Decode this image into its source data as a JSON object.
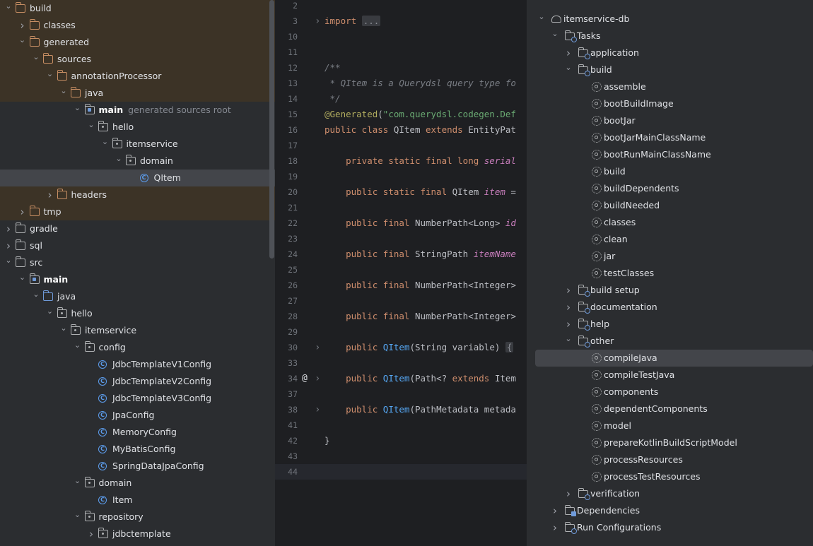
{
  "project_tree": {
    "rows": [
      {
        "label": "build",
        "icon": "folder-icon",
        "variant": "orange",
        "depth": 0,
        "chevron": "down",
        "excluded": true
      },
      {
        "label": "classes",
        "icon": "folder-icon",
        "variant": "orange",
        "depth": 1,
        "chevron": "right",
        "excluded": true
      },
      {
        "label": "generated",
        "icon": "folder-icon",
        "variant": "orange",
        "depth": 1,
        "chevron": "down",
        "excluded": true
      },
      {
        "label": "sources",
        "icon": "folder-icon",
        "variant": "orange",
        "depth": 2,
        "chevron": "down",
        "excluded": true
      },
      {
        "label": "annotationProcessor",
        "icon": "folder-icon",
        "variant": "orange",
        "depth": 3,
        "chevron": "down",
        "excluded": true
      },
      {
        "label": "java",
        "icon": "folder-icon",
        "variant": "orange",
        "depth": 4,
        "chevron": "down",
        "excluded": true
      },
      {
        "label": "main",
        "hint": "generated sources root",
        "icon": "source-root-icon",
        "variant": "src",
        "depth": 5,
        "chevron": "down",
        "bold": true
      },
      {
        "label": "hello",
        "icon": "package-icon",
        "variant": "pkg",
        "depth": 6,
        "chevron": "down"
      },
      {
        "label": "itemservice",
        "icon": "package-icon",
        "variant": "pkg",
        "depth": 7,
        "chevron": "down"
      },
      {
        "label": "domain",
        "icon": "package-icon",
        "variant": "pkg",
        "depth": 8,
        "chevron": "down"
      },
      {
        "label": "QItem",
        "icon": "class-icon",
        "depth": 9,
        "chevron": "none",
        "selected": true
      },
      {
        "label": "headers",
        "icon": "folder-icon",
        "variant": "orange",
        "depth": 3,
        "chevron": "right",
        "excluded": true
      },
      {
        "label": "tmp",
        "icon": "folder-icon",
        "variant": "orange",
        "depth": 1,
        "chevron": "right",
        "excluded": true
      },
      {
        "label": "gradle",
        "icon": "folder-icon",
        "variant": "plain",
        "depth": 0,
        "chevron": "right"
      },
      {
        "label": "sql",
        "icon": "folder-icon",
        "variant": "plain",
        "depth": 0,
        "chevron": "right"
      },
      {
        "label": "src",
        "icon": "folder-icon",
        "variant": "plain",
        "depth": 0,
        "chevron": "down"
      },
      {
        "label": "main",
        "icon": "module-folder-icon",
        "variant": "src",
        "depth": 1,
        "chevron": "down",
        "bold": true
      },
      {
        "label": "java",
        "icon": "folder-icon",
        "variant": "blue",
        "depth": 2,
        "chevron": "down"
      },
      {
        "label": "hello",
        "icon": "package-icon",
        "variant": "pkg",
        "depth": 3,
        "chevron": "down"
      },
      {
        "label": "itemservice",
        "icon": "package-icon",
        "variant": "pkg",
        "depth": 4,
        "chevron": "down"
      },
      {
        "label": "config",
        "icon": "package-icon",
        "variant": "pkg",
        "depth": 5,
        "chevron": "down"
      },
      {
        "label": "JdbcTemplateV1Config",
        "icon": "class-icon",
        "depth": 6,
        "chevron": "none"
      },
      {
        "label": "JdbcTemplateV2Config",
        "icon": "class-icon",
        "depth": 6,
        "chevron": "none"
      },
      {
        "label": "JdbcTemplateV3Config",
        "icon": "class-icon",
        "depth": 6,
        "chevron": "none"
      },
      {
        "label": "JpaConfig",
        "icon": "class-icon",
        "depth": 6,
        "chevron": "none"
      },
      {
        "label": "MemoryConfig",
        "icon": "class-icon",
        "depth": 6,
        "chevron": "none"
      },
      {
        "label": "MyBatisConfig",
        "icon": "class-icon",
        "depth": 6,
        "chevron": "none"
      },
      {
        "label": "SpringDataJpaConfig",
        "icon": "class-icon",
        "depth": 6,
        "chevron": "none"
      },
      {
        "label": "domain",
        "icon": "package-icon",
        "variant": "pkg",
        "depth": 5,
        "chevron": "down"
      },
      {
        "label": "Item",
        "icon": "class-icon",
        "depth": 6,
        "chevron": "none"
      },
      {
        "label": "repository",
        "icon": "package-icon",
        "variant": "pkg",
        "depth": 5,
        "chevron": "down"
      },
      {
        "label": "jdbctemplate",
        "icon": "package-icon",
        "variant": "pkg",
        "depth": 6,
        "chevron": "right"
      }
    ]
  },
  "editor": {
    "current_line": "44",
    "lines": [
      {
        "n": "2",
        "segs": []
      },
      {
        "n": "3",
        "fold": true,
        "segs": [
          [
            "kw",
            "import "
          ],
          [
            "coll",
            "..."
          ]
        ]
      },
      {
        "n": "10",
        "segs": []
      },
      {
        "n": "11",
        "segs": []
      },
      {
        "n": "12",
        "segs": [
          [
            "cm",
            "/**"
          ]
        ]
      },
      {
        "n": "13",
        "segs": [
          [
            "cm",
            " * QItem is a Querydsl query type fo"
          ]
        ]
      },
      {
        "n": "14",
        "segs": [
          [
            "cm",
            " */"
          ]
        ]
      },
      {
        "n": "15",
        "segs": [
          [
            "an",
            "@Generated"
          ],
          [
            "tx",
            "("
          ],
          [
            "st",
            "\"com.querydsl.codegen.Def"
          ]
        ]
      },
      {
        "n": "16",
        "segs": [
          [
            "kw",
            "public class "
          ],
          [
            "tx",
            "QItem "
          ],
          [
            "kw",
            "extends "
          ],
          [
            "tx",
            "EntityPat"
          ]
        ]
      },
      {
        "n": "17",
        "segs": []
      },
      {
        "n": "18",
        "segs": [
          [
            "tx",
            "    "
          ],
          [
            "kw",
            "private static final long "
          ],
          [
            "fi",
            "serial"
          ]
        ]
      },
      {
        "n": "19",
        "segs": []
      },
      {
        "n": "20",
        "segs": [
          [
            "tx",
            "    "
          ],
          [
            "kw",
            "public static final "
          ],
          [
            "tx",
            "QItem "
          ],
          [
            "fi",
            "item "
          ],
          [
            "tx",
            "="
          ]
        ]
      },
      {
        "n": "21",
        "segs": []
      },
      {
        "n": "22",
        "segs": [
          [
            "tx",
            "    "
          ],
          [
            "kw",
            "public final "
          ],
          [
            "tx",
            "NumberPath<Long> "
          ],
          [
            "fi",
            "id"
          ]
        ]
      },
      {
        "n": "23",
        "segs": []
      },
      {
        "n": "24",
        "segs": [
          [
            "tx",
            "    "
          ],
          [
            "kw",
            "public final "
          ],
          [
            "tx",
            "StringPath "
          ],
          [
            "fi",
            "itemName"
          ]
        ]
      },
      {
        "n": "25",
        "segs": []
      },
      {
        "n": "26",
        "segs": [
          [
            "tx",
            "    "
          ],
          [
            "kw",
            "public final "
          ],
          [
            "tx",
            "NumberPath<Integer>"
          ]
        ]
      },
      {
        "n": "27",
        "segs": []
      },
      {
        "n": "28",
        "segs": [
          [
            "tx",
            "    "
          ],
          [
            "kw",
            "public final "
          ],
          [
            "tx",
            "NumberPath<Integer>"
          ]
        ]
      },
      {
        "n": "29",
        "segs": []
      },
      {
        "n": "30",
        "fold": true,
        "segs": [
          [
            "tx",
            "    "
          ],
          [
            "kw",
            "public "
          ],
          [
            "fn",
            "QItem"
          ],
          [
            "tx",
            "(String variable) "
          ],
          [
            "coll",
            "{"
          ]
        ]
      },
      {
        "n": "33",
        "segs": []
      },
      {
        "n": "34",
        "fold": true,
        "at": true,
        "segs": [
          [
            "tx",
            "    "
          ],
          [
            "kw",
            "public "
          ],
          [
            "fn",
            "QItem"
          ],
          [
            "tx",
            "(Path<? "
          ],
          [
            "kw",
            "extends "
          ],
          [
            "tx",
            "Item"
          ]
        ]
      },
      {
        "n": "37",
        "segs": []
      },
      {
        "n": "38",
        "fold": true,
        "segs": [
          [
            "tx",
            "    "
          ],
          [
            "kw",
            "public "
          ],
          [
            "fn",
            "QItem"
          ],
          [
            "tx",
            "(PathMetadata metada"
          ]
        ]
      },
      {
        "n": "41",
        "segs": []
      },
      {
        "n": "42",
        "segs": [
          [
            "tx",
            "}"
          ]
        ]
      },
      {
        "n": "43",
        "segs": []
      },
      {
        "n": "44",
        "segs": []
      }
    ]
  },
  "gradle": {
    "rows": [
      {
        "label": "itemservice-db",
        "icon": "elephant-icon",
        "depth": 0,
        "chevron": "down"
      },
      {
        "label": "Tasks",
        "icon": "task-folder-icon",
        "depth": 1,
        "chevron": "down"
      },
      {
        "label": "application",
        "icon": "task-folder-icon",
        "depth": 2,
        "chevron": "right"
      },
      {
        "label": "build",
        "icon": "task-folder-icon",
        "depth": 2,
        "chevron": "down"
      },
      {
        "label": "assemble",
        "icon": "gear-icon",
        "depth": 3,
        "chevron": "none"
      },
      {
        "label": "bootBuildImage",
        "icon": "gear-icon",
        "depth": 3,
        "chevron": "none"
      },
      {
        "label": "bootJar",
        "icon": "gear-icon",
        "depth": 3,
        "chevron": "none"
      },
      {
        "label": "bootJarMainClassName",
        "icon": "gear-icon",
        "depth": 3,
        "chevron": "none"
      },
      {
        "label": "bootRunMainClassName",
        "icon": "gear-icon",
        "depth": 3,
        "chevron": "none"
      },
      {
        "label": "build",
        "icon": "gear-icon",
        "depth": 3,
        "chevron": "none"
      },
      {
        "label": "buildDependents",
        "icon": "gear-icon",
        "depth": 3,
        "chevron": "none"
      },
      {
        "label": "buildNeeded",
        "icon": "gear-icon",
        "depth": 3,
        "chevron": "none"
      },
      {
        "label": "classes",
        "icon": "gear-icon",
        "depth": 3,
        "chevron": "none"
      },
      {
        "label": "clean",
        "icon": "gear-icon",
        "depth": 3,
        "chevron": "none"
      },
      {
        "label": "jar",
        "icon": "gear-icon",
        "depth": 3,
        "chevron": "none"
      },
      {
        "label": "testClasses",
        "icon": "gear-icon",
        "depth": 3,
        "chevron": "none"
      },
      {
        "label": "build setup",
        "icon": "task-folder-icon",
        "depth": 2,
        "chevron": "right"
      },
      {
        "label": "documentation",
        "icon": "task-folder-icon",
        "depth": 2,
        "chevron": "right"
      },
      {
        "label": "help",
        "icon": "task-folder-icon",
        "depth": 2,
        "chevron": "right"
      },
      {
        "label": "other",
        "icon": "task-folder-icon",
        "depth": 2,
        "chevron": "down"
      },
      {
        "label": "compileJava",
        "icon": "gear-icon",
        "depth": 3,
        "chevron": "none",
        "selected": true
      },
      {
        "label": "compileTestJava",
        "icon": "gear-icon",
        "depth": 3,
        "chevron": "none"
      },
      {
        "label": "components",
        "icon": "gear-icon",
        "depth": 3,
        "chevron": "none"
      },
      {
        "label": "dependentComponents",
        "icon": "gear-icon",
        "depth": 3,
        "chevron": "none"
      },
      {
        "label": "model",
        "icon": "gear-icon",
        "depth": 3,
        "chevron": "none"
      },
      {
        "label": "prepareKotlinBuildScriptModel",
        "icon": "gear-icon",
        "depth": 3,
        "chevron": "none"
      },
      {
        "label": "processResources",
        "icon": "gear-icon",
        "depth": 3,
        "chevron": "none"
      },
      {
        "label": "processTestResources",
        "icon": "gear-icon",
        "depth": 3,
        "chevron": "none"
      },
      {
        "label": "verification",
        "icon": "task-folder-icon",
        "depth": 2,
        "chevron": "right"
      },
      {
        "label": "Dependencies",
        "icon": "dependencies-icon",
        "depth": 1,
        "chevron": "right"
      },
      {
        "label": "Run Configurations",
        "icon": "run-config-folder-icon",
        "depth": 1,
        "chevron": "right"
      }
    ]
  },
  "colors": {
    "excluded_row": "#3c3326",
    "selection": "#43454a",
    "keyword": "#cf8e6d",
    "string": "#6aab73",
    "comment": "#7a7e85",
    "annotation": "#b3ae60",
    "method": "#56a8f5",
    "field": "#c77dbb",
    "class_icon": "#5c9ded"
  }
}
